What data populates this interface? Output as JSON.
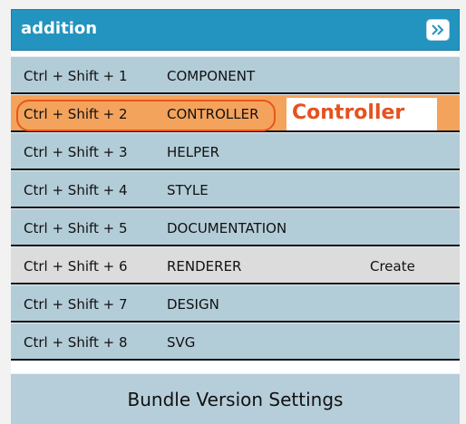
{
  "header": {
    "title": "addition"
  },
  "rows": [
    {
      "shortcut": "Ctrl + Shift + 1",
      "name": "COMPONENT",
      "action": ""
    },
    {
      "shortcut": "Ctrl + Shift + 2",
      "name": "CONTROLLER",
      "action": ""
    },
    {
      "shortcut": "Ctrl + Shift + 3",
      "name": "HELPER",
      "action": ""
    },
    {
      "shortcut": "Ctrl + Shift + 4",
      "name": "STYLE",
      "action": ""
    },
    {
      "shortcut": "Ctrl + Shift + 5",
      "name": "DOCUMENTATION",
      "action": ""
    },
    {
      "shortcut": "Ctrl + Shift + 6",
      "name": "RENDERER",
      "action": "Create"
    },
    {
      "shortcut": "Ctrl + Shift + 7",
      "name": "DESIGN",
      "action": ""
    },
    {
      "shortcut": "Ctrl + Shift + 8",
      "name": "SVG",
      "action": ""
    }
  ],
  "callout": {
    "label": "Controller"
  },
  "bundle_button": {
    "label": "Bundle Version Settings"
  },
  "colors": {
    "header_bg": "#2294bf",
    "row_bg": "#b3cdd8",
    "active_row_bg": "#f4a35c",
    "hover_row_bg": "#dcdcdc",
    "annotation": "#e5521e"
  },
  "icons": {
    "expand": "double-chevron-right-icon"
  }
}
